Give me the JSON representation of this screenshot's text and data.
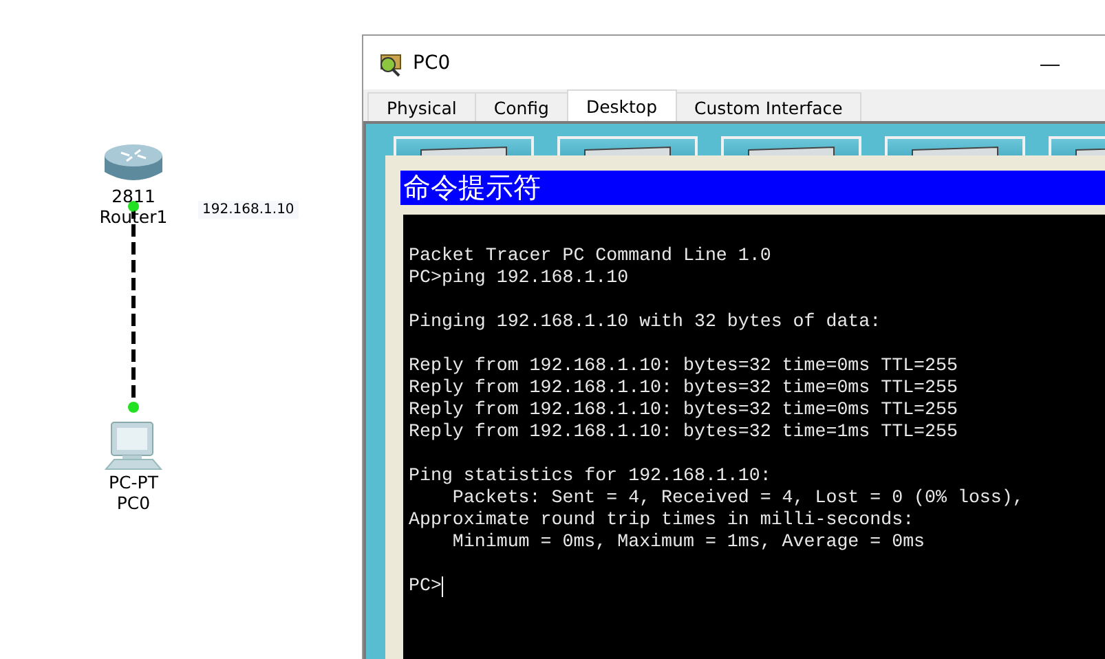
{
  "topology": {
    "devices": [
      {
        "kind": "router",
        "model": "2811",
        "name": "Router1"
      },
      {
        "kind": "pc",
        "model": "PC-PT",
        "name": "PC0"
      }
    ],
    "ip_label": "192.168.1.10"
  },
  "window": {
    "title": "PC0",
    "minimize": "—"
  },
  "tabs": [
    {
      "label": "Physical",
      "selected": false
    },
    {
      "label": "Config",
      "selected": false
    },
    {
      "label": "Desktop",
      "selected": true
    },
    {
      "label": "Custom Interface",
      "selected": false
    }
  ],
  "command_prompt": {
    "title": "命令提示符",
    "blocks": [
      [
        "Packet Tracer PC Command Line 1.0",
        "PC>ping 192.168.1.10"
      ],
      [
        "Pinging 192.168.1.10 with 32 bytes of data:"
      ],
      [
        "Reply from 192.168.1.10: bytes=32 time=0ms TTL=255",
        "Reply from 192.168.1.10: bytes=32 time=0ms TTL=255",
        "Reply from 192.168.1.10: bytes=32 time=0ms TTL=255",
        "Reply from 192.168.1.10: bytes=32 time=1ms TTL=255"
      ],
      [
        "Ping statistics for 192.168.1.10:",
        "    Packets: Sent = 4, Received = 4, Lost = 0 (0% loss),",
        "Approximate round trip times in milli-seconds:",
        "    Minimum = 0ms, Maximum = 1ms, Average = 0ms"
      ]
    ],
    "prompt": "PC>"
  }
}
